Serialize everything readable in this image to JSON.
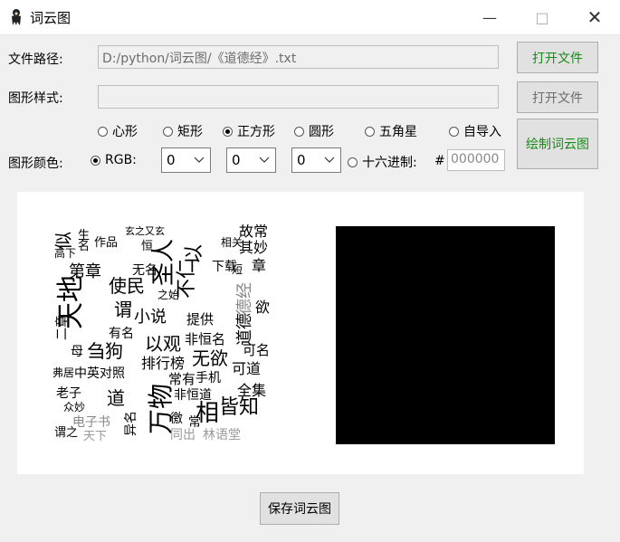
{
  "window": {
    "title": "词云图",
    "icons": {
      "app": "ink-figure-icon",
      "min": "minimize-icon",
      "max": "maximize-icon",
      "close": "close-icon"
    }
  },
  "form": {
    "path_label": "文件路径:",
    "path_value": "D:/python/词云图/《道德经》.txt",
    "open_file_1": "打开文件",
    "style_label": "图形样式:",
    "style_value": "",
    "open_file_2": "打开文件",
    "shapes": [
      "心形",
      "矩形",
      "正方形",
      "圆形",
      "五角星",
      "自导入"
    ],
    "shape_selected": "正方形",
    "draw_button": "绘制词云图",
    "color_label": "图形颜色:",
    "rgb_label": "RGB:",
    "r": "0",
    "g": "0",
    "b": "0",
    "hex_label": "十六进制:",
    "hash": "#",
    "hex_placeholder": "000000",
    "color_mode_selected": "RGB"
  },
  "wordcloud_words": [
    "天地",
    "万物",
    "圣人",
    "不仁",
    "以",
    "似",
    "第章",
    "使民",
    "刍狗",
    "道",
    "相",
    "皆知",
    "小说",
    "谓",
    "以观",
    "无欲",
    "德经",
    "道德",
    "章",
    "常",
    "无名",
    "有名",
    "排行榜",
    "可道",
    "提供",
    "非恒名",
    "下载",
    "其妙",
    "故常",
    "全集",
    "手机",
    "常有",
    "同出",
    "林语堂",
    "电子书",
    "异名",
    "中英对照",
    "老子",
    "众妙",
    "名",
    "可名",
    "非恒道",
    "徼",
    "二章",
    "欲",
    "之始",
    "短",
    "相关",
    "作品",
    "母",
    "玄之又玄",
    "高下",
    "生",
    "弗居",
    "天下",
    "谓之",
    "恒"
  ],
  "save_button": "保存词云图"
}
